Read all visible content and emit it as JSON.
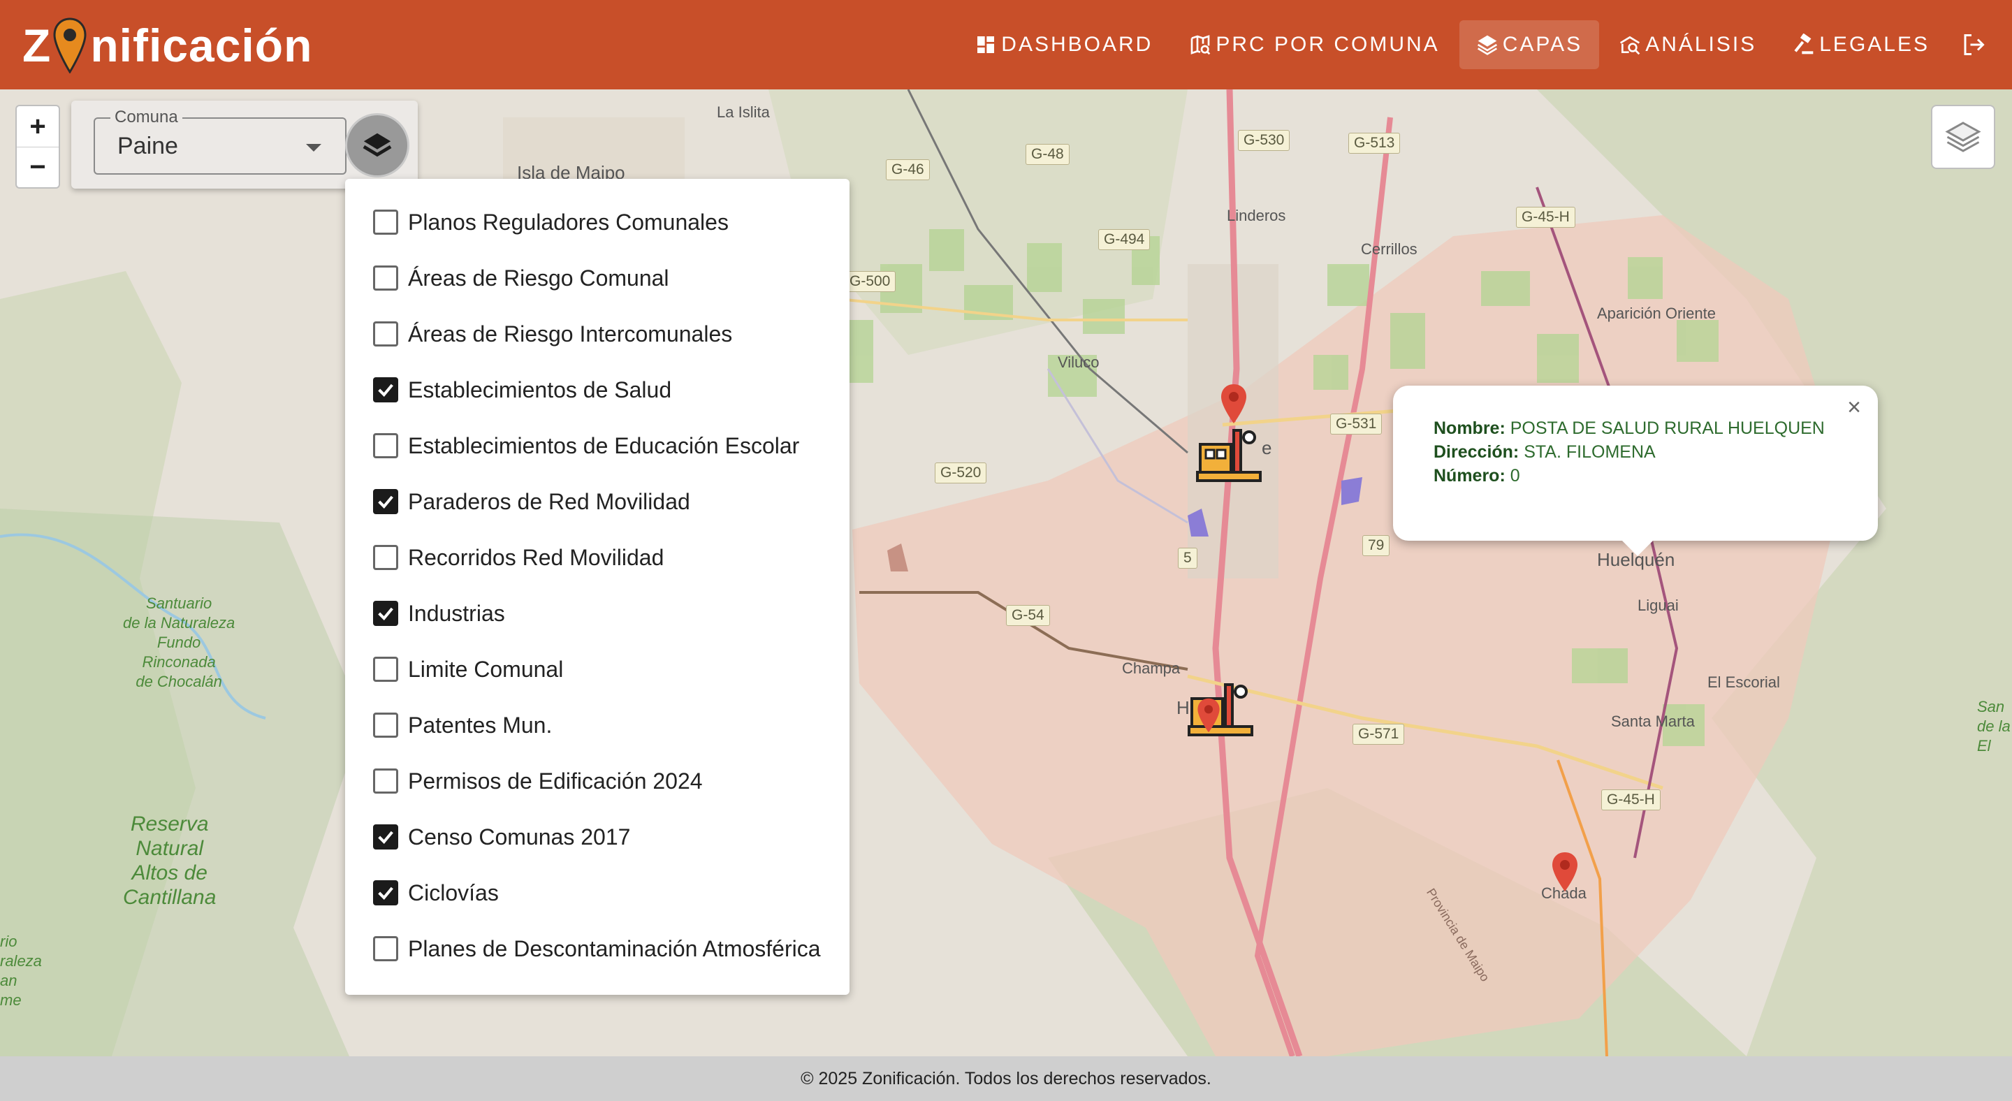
{
  "app": {
    "logo_pre": "Z",
    "logo_post": "nificación",
    "brand_color": "#c84f29"
  },
  "nav": {
    "items": [
      {
        "label": "DASHBOARD",
        "icon": "dashboard-icon"
      },
      {
        "label": "PRC POR COMUNA",
        "icon": "map-search-icon"
      },
      {
        "label": "CAPAS",
        "icon": "layers-icon",
        "active": true
      },
      {
        "label": "ANÁLISIS",
        "icon": "analysis-icon"
      },
      {
        "label": "LEGALES",
        "icon": "gavel-icon"
      }
    ],
    "logout_icon": "logout-icon"
  },
  "map_controls": {
    "zoom_in": "+",
    "zoom_out": "−"
  },
  "comuna": {
    "legend": "Comuna",
    "value": "Paine"
  },
  "layers": [
    {
      "label": "Planos Reguladores Comunales",
      "checked": false
    },
    {
      "label": "Áreas de Riesgo Comunal",
      "checked": false
    },
    {
      "label": "Áreas de Riesgo Intercomunales",
      "checked": false
    },
    {
      "label": "Establecimientos de Salud",
      "checked": true
    },
    {
      "label": "Establecimientos de Educación Escolar",
      "checked": false
    },
    {
      "label": "Paraderos de Red Movilidad",
      "checked": true
    },
    {
      "label": "Recorridos Red Movilidad",
      "checked": false
    },
    {
      "label": "Industrias",
      "checked": true
    },
    {
      "label": "Limite Comunal",
      "checked": false
    },
    {
      "label": "Patentes Mun.",
      "checked": false
    },
    {
      "label": "Permisos de Edificación 2024",
      "checked": false
    },
    {
      "label": "Censo Comunas 2017",
      "checked": true
    },
    {
      "label": "Ciclovías",
      "checked": true
    },
    {
      "label": "Planes de Descontaminación Atmosférica",
      "checked": false
    }
  ],
  "popup": {
    "close": "×",
    "nombre_label": "Nombre:",
    "nombre_value": "POSTA DE SALUD RURAL HUELQUEN",
    "direccion_label": "Dirección:",
    "direccion_value": "STA. FILOMENA",
    "numero_label": "Número:",
    "numero_value": "0"
  },
  "map_labels": {
    "la_islita": "La Islita",
    "isla_de_maipo": "Isla de Maipo",
    "linderos": "Linderos",
    "cerrillos": "Cerrillos",
    "aparicion_oriente": "Aparición Oriente",
    "viluco": "Viluco",
    "huelquen": "Huelquén",
    "liguai": "Liguai",
    "el_escorial": "El Escorial",
    "santa_marta": "Santa Marta",
    "champa": "Champa",
    "chada": "Chada",
    "santuario": "Santuario\nde la Naturaleza\nFundo\nRinconada\nde Chocalán",
    "reserva": "Reserva\nNatural\nAltos de\nCantillana",
    "right_edge": "San\nde la N\nEl",
    "left_edge": "rio\nraleza\nan\nme",
    "provincia": "Provincia de Maipo",
    "paine_partial": "e",
    "h_partial": "H"
  },
  "road_shields": [
    "G-530",
    "G-513",
    "G-46",
    "G-48",
    "G-494",
    "G-500",
    "G-45-H",
    "G-531",
    "G-520",
    "G-54",
    "G-571",
    "G-45-H",
    "79",
    "5"
  ],
  "footer": {
    "text": "© 2025 Zonificación. Todos los derechos reservados."
  }
}
